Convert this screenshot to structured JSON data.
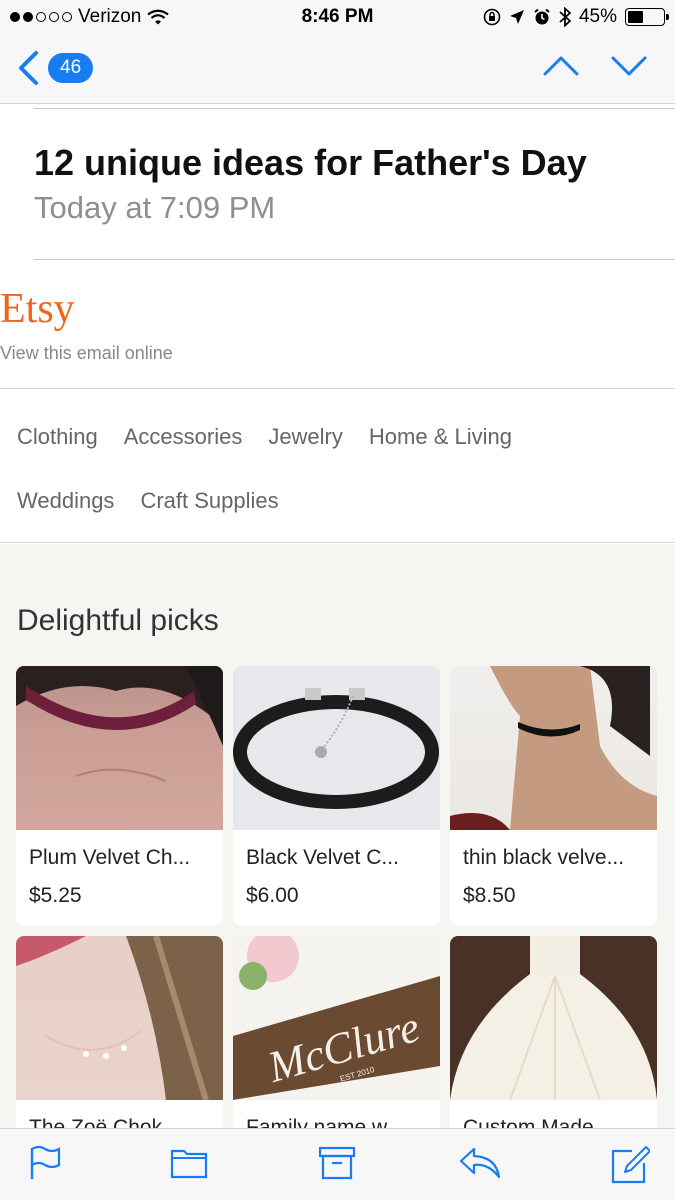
{
  "status_bar": {
    "carrier": "Verizon",
    "time": "8:46 PM",
    "battery_percent": "45%",
    "battery_level": 0.45,
    "signal_bars": 2,
    "icons": [
      "wifi-icon",
      "orientation-lock-icon",
      "location-arrow-icon",
      "alarm-icon",
      "bluetooth-icon",
      "battery-icon"
    ]
  },
  "mail_nav": {
    "back_count": "46",
    "icons": [
      "back-chevron-icon",
      "previous-message-icon",
      "next-message-icon"
    ]
  },
  "email": {
    "subject": "12 unique ideas for Father's Day",
    "date": "Today at 7:09 PM"
  },
  "etsy": {
    "logo": "Etsy",
    "view_online": "View this email online"
  },
  "categories": [
    "Clothing",
    "Accessories",
    "Jewelry",
    "Home & Living",
    "Weddings",
    "Craft Supplies"
  ],
  "picks": {
    "title": "Delightful picks",
    "items": [
      {
        "title": "Plum Velvet Ch...",
        "price": "$5.25"
      },
      {
        "title": "Black Velvet C...",
        "price": "$6.00"
      },
      {
        "title": "thin black velve...",
        "price": "$8.50"
      },
      {
        "title": "The Zoë Chok...",
        "price": ""
      },
      {
        "title": "Family name w...",
        "price": ""
      },
      {
        "title": "Custom Made ...",
        "price": ""
      }
    ],
    "sign_text": "McClure",
    "sign_subtext": "EST 2010"
  },
  "toolbar": {
    "icons": [
      "flag-icon",
      "folder-icon",
      "archive-icon",
      "reply-icon",
      "compose-icon"
    ]
  },
  "colors": {
    "accent": "#1a7cf3",
    "etsy_orange": "#f1641e",
    "gray_text": "#8e8e93",
    "picks_bg": "#f5f5f1"
  }
}
